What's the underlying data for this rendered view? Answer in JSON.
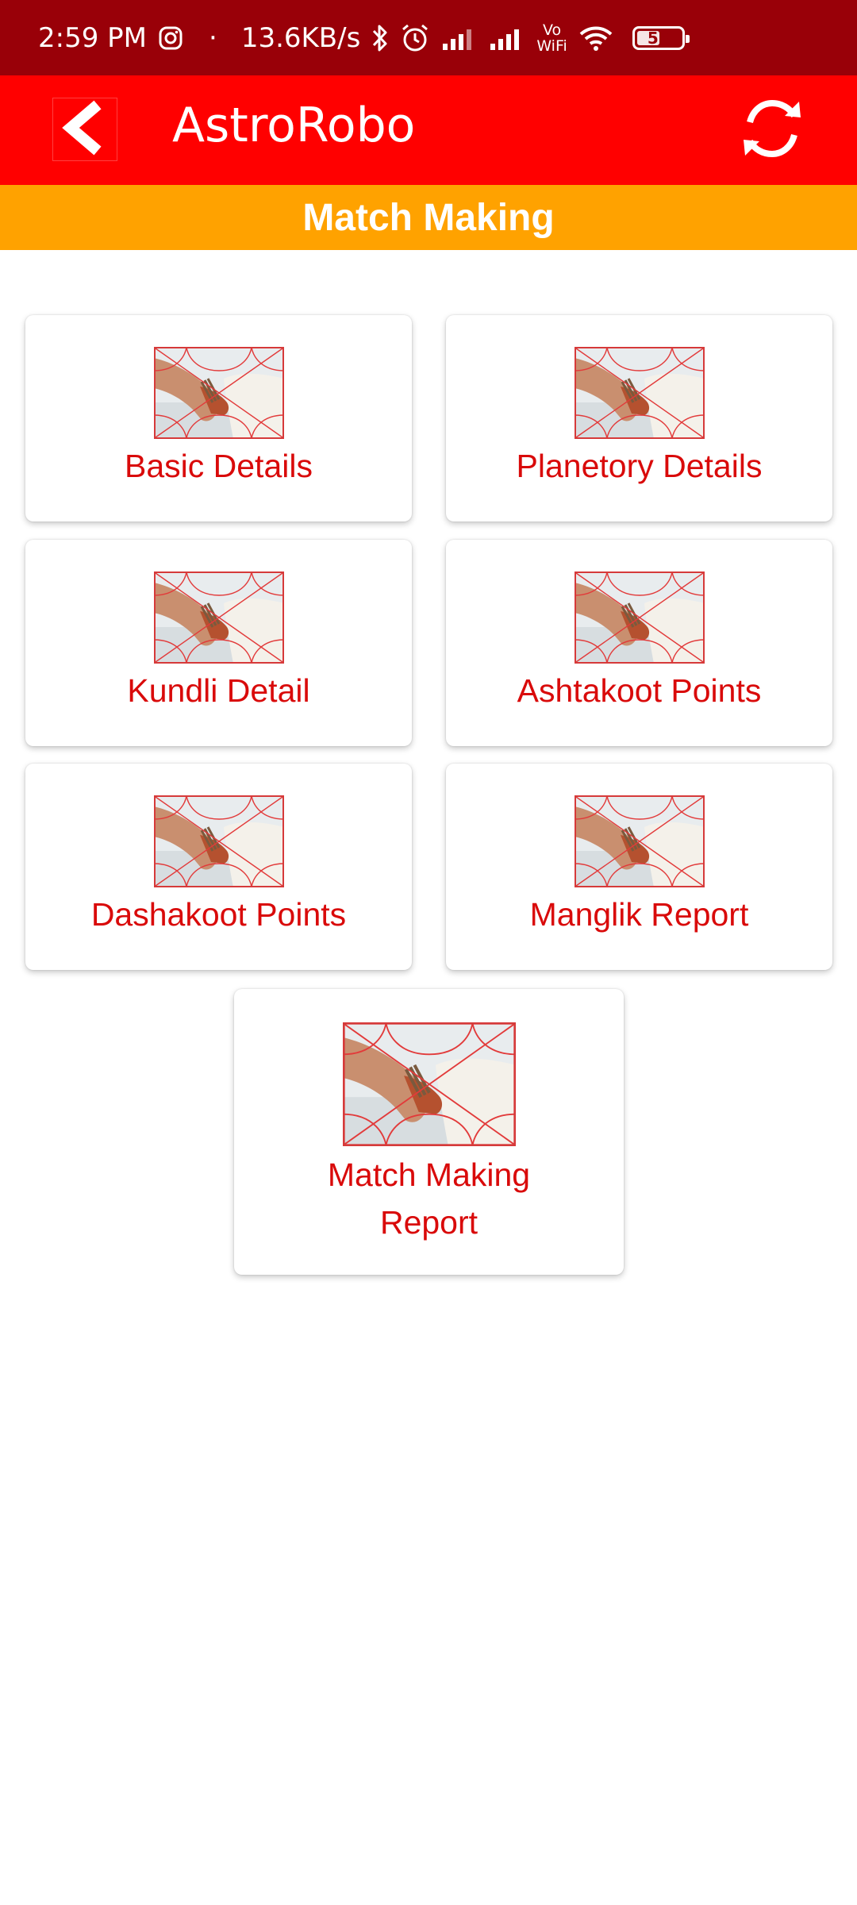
{
  "status_bar": {
    "time": "2:59 PM",
    "dot": "·",
    "speed": "13.6KB/s",
    "battery": "53",
    "battery_level": 0.53,
    "icons": [
      "instagram-icon",
      "bluetooth-icon",
      "alarm-icon",
      "signal-icon",
      "signal-icon",
      "vowifi-icon",
      "wifi-icon",
      "battery-icon"
    ],
    "vowifi_top": "Vo",
    "vowifi_bottom": "WiFi"
  },
  "app_bar": {
    "title": "AstroRobo",
    "back_icon": "chevron-left-icon",
    "refresh_icon": "refresh-icon"
  },
  "subheader": {
    "title": "Match Making"
  },
  "menu": {
    "items": [
      {
        "label": "Basic Details"
      },
      {
        "label": "Planetory Details"
      },
      {
        "label": "Kundli Detail"
      },
      {
        "label": "Ashtakoot Points"
      },
      {
        "label": "Dashakoot Points"
      },
      {
        "label": "Manglik Report"
      },
      {
        "label_line1": "Match Making",
        "label_line2": "Report"
      }
    ]
  },
  "colors": {
    "status_bar": "#990008",
    "app_bar": "#ff0000",
    "subheader": "#ffa200",
    "card_text": "#d90a0a"
  }
}
